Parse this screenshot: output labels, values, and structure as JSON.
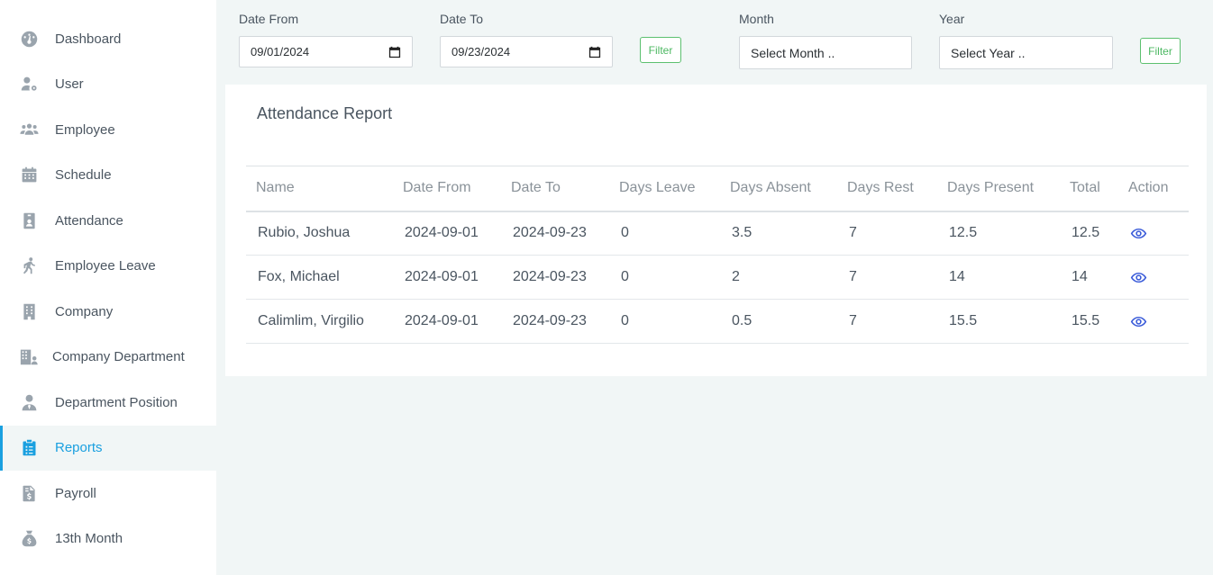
{
  "sidebar": {
    "items": [
      {
        "label": "Dashboard",
        "icon": "dashboard-icon"
      },
      {
        "label": "User",
        "icon": "user-gear-icon"
      },
      {
        "label": "Employee",
        "icon": "users-icon"
      },
      {
        "label": "Schedule",
        "icon": "calendar-icon"
      },
      {
        "label": "Attendance",
        "icon": "id-badge-icon"
      },
      {
        "label": "Employee Leave",
        "icon": "walking-icon"
      },
      {
        "label": "Company",
        "icon": "building-icon"
      },
      {
        "label": "Company Department",
        "icon": "department-icon"
      },
      {
        "label": "Department Position",
        "icon": "user-tie-icon"
      },
      {
        "label": "Reports",
        "icon": "clipboard-list-icon",
        "active": true
      },
      {
        "label": "Payroll",
        "icon": "invoice-dollar-icon"
      },
      {
        "label": "13th Month",
        "icon": "money-bag-icon"
      }
    ]
  },
  "filters": {
    "date_from_label": "Date From",
    "date_from_value": "09/01/2024",
    "date_to_label": "Date To",
    "date_to_value": "09/23/2024",
    "filter_label": "Filter",
    "month_label": "Month",
    "month_placeholder": "Select Month ..",
    "year_label": "Year",
    "year_placeholder": "Select Year ..",
    "filter2_label": "Filter"
  },
  "report": {
    "title": "Attendance Report",
    "columns": [
      "Name",
      "Date From",
      "Date To",
      "Days Leave",
      "Days Absent",
      "Days Rest",
      "Days Present",
      "Total",
      "Action"
    ],
    "rows": [
      [
        "Rubio, Joshua",
        "2024-09-01",
        "2024-09-23",
        "0",
        "3.5",
        "7",
        "12.5",
        "12.5"
      ],
      [
        "Fox, Michael",
        "2024-09-01",
        "2024-09-23",
        "0",
        "2",
        "7",
        "14",
        "14"
      ],
      [
        "Calimlim, Virgilio",
        "2024-09-01",
        "2024-09-23",
        "0",
        "0.5",
        "7",
        "15.5",
        "15.5"
      ]
    ]
  },
  "colors": {
    "accent": "#1aa0e0",
    "filter_green": "#4cb862",
    "eye_blue": "#3a5bd9",
    "background": "#f1f6f6"
  }
}
